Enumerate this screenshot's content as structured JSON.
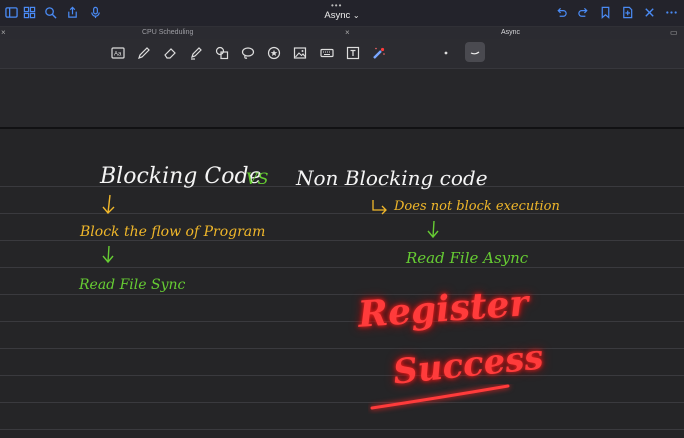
{
  "header": {
    "title": "Async",
    "more_dots": "•••",
    "title_chevron": "⌄"
  },
  "tabs": [
    {
      "label": "CPU Scheduling"
    },
    {
      "label": "Async"
    }
  ],
  "toolbar": {
    "tools": [
      "scan-icon",
      "pen-icon",
      "eraser-icon",
      "highlighter-icon",
      "shapes-icon",
      "lasso-icon",
      "sticker-icon",
      "image-icon",
      "keyboard-icon",
      "textbox-icon",
      "laser-pointer-icon"
    ],
    "accent": "#4a8bf5"
  },
  "notes": {
    "heading_left": "Blocking Code",
    "vs": "VS",
    "heading_right": "Non Blocking code",
    "left_desc": "Block the flow of Program",
    "left_example": "Read File Sync",
    "right_desc": "Does not block execution",
    "right_example": "Read File Async",
    "red_line1": "Register",
    "red_line2": "Success",
    "colors": {
      "white": "#f4f4f4",
      "yellow": "#f0b72a",
      "green": "#66cc33",
      "red": "#ff3b3b"
    }
  }
}
